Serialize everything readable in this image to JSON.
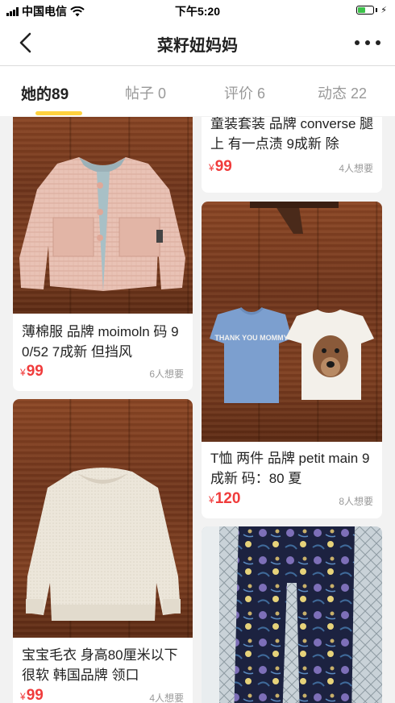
{
  "status_bar": {
    "carrier": "中国电信",
    "time": "下午5:20",
    "wifi_icon": "wifi-icon",
    "battery_icon": "battery-charging-icon",
    "battery_level": 0.55,
    "battery_color": "#3cc24a"
  },
  "nav": {
    "title": "菜籽妞妈妈",
    "back_icon": "chevron-left-icon",
    "more_icon": "more-dots-icon"
  },
  "tabs": [
    {
      "label": "她的89",
      "active": true
    },
    {
      "label": "帖子 0",
      "active": false
    },
    {
      "label": "评价 6",
      "active": false
    },
    {
      "label": "动态 22",
      "active": false
    }
  ],
  "accent_color": "#ffd23f",
  "price_color": "#f03c3c",
  "currency_symbol": "¥",
  "items": [
    {
      "description": "薄棉服 品牌 moimoln 码 90/52 7成新 但挡风",
      "price": "99",
      "wants": "6人想要",
      "photo": "pink-knit-jacket"
    },
    {
      "description": "宝宝毛衣 身高80厘米以下 很软 韩国品牌 领口",
      "price": "99",
      "wants": "4人想要",
      "photo": "cream-sweater"
    },
    {
      "description": "童装套装 品牌 converse 腿上 有一点渍 9成新 除",
      "price": "99",
      "wants": "4人想要",
      "photo": ""
    },
    {
      "description": "T恤 两件 品牌 petit main 9成新 码：80 夏",
      "price": "120",
      "wants": "8人想要",
      "photo": "two-tshirts",
      "shirt_text": "THANK YOU MOMMY"
    },
    {
      "description": "",
      "price": "",
      "wants": "",
      "photo": "floral-pants"
    }
  ]
}
